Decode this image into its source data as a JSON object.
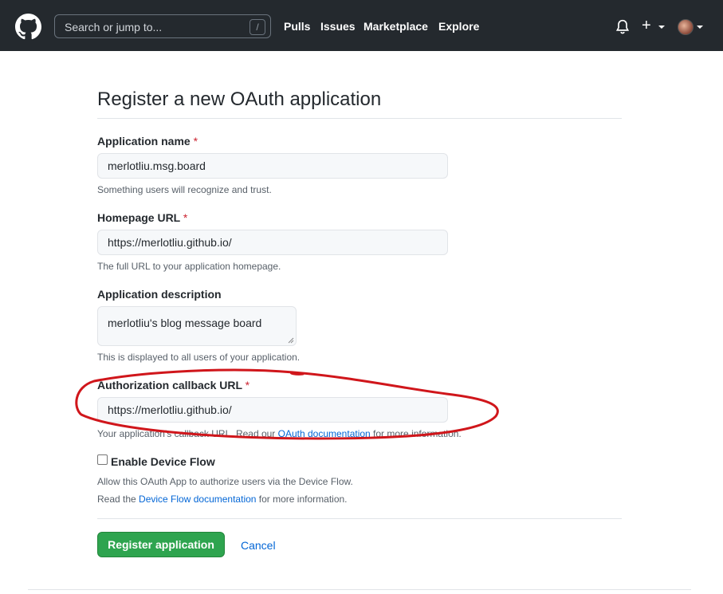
{
  "header": {
    "search_placeholder": "Search or jump to...",
    "search_shortcut": "/",
    "nav": [
      "Pulls",
      "Issues",
      "Marketplace",
      "Explore"
    ],
    "plus_symbol": "+"
  },
  "page": {
    "title": "Register a new OAuth application"
  },
  "form": {
    "app_name_label": "Application name",
    "required_mark": "*",
    "app_name_value": "merlotliu.msg.board",
    "app_name_note": "Something users will recognize and trust.",
    "homepage_label": "Homepage URL",
    "homepage_value": "https://merlotliu.github.io/",
    "homepage_note": "The full URL to your application homepage.",
    "description_label": "Application description",
    "description_value": "merlotliu's blog message board",
    "description_note": "This is displayed to all users of your application.",
    "callback_label": "Authorization callback URL",
    "callback_value": "https://merlotliu.github.io/",
    "callback_note_pre": "Your application's callback URL. Read our ",
    "callback_note_link": "OAuth documentation",
    "callback_note_post": " for more information.",
    "device_flow_label": "Enable Device Flow",
    "device_flow_note1": "Allow this OAuth App to authorize users via the Device Flow.",
    "device_flow_note2_pre": "Read the ",
    "device_flow_note2_link": "Device Flow documentation",
    "device_flow_note2_post": " for more information.",
    "register_button": "Register application",
    "cancel_link": "Cancel"
  },
  "colors": {
    "header_bg": "#24292e",
    "primary_button": "#2ea44f",
    "link": "#0366d6",
    "required": "#cb2431",
    "annotation": "#d0161b"
  }
}
